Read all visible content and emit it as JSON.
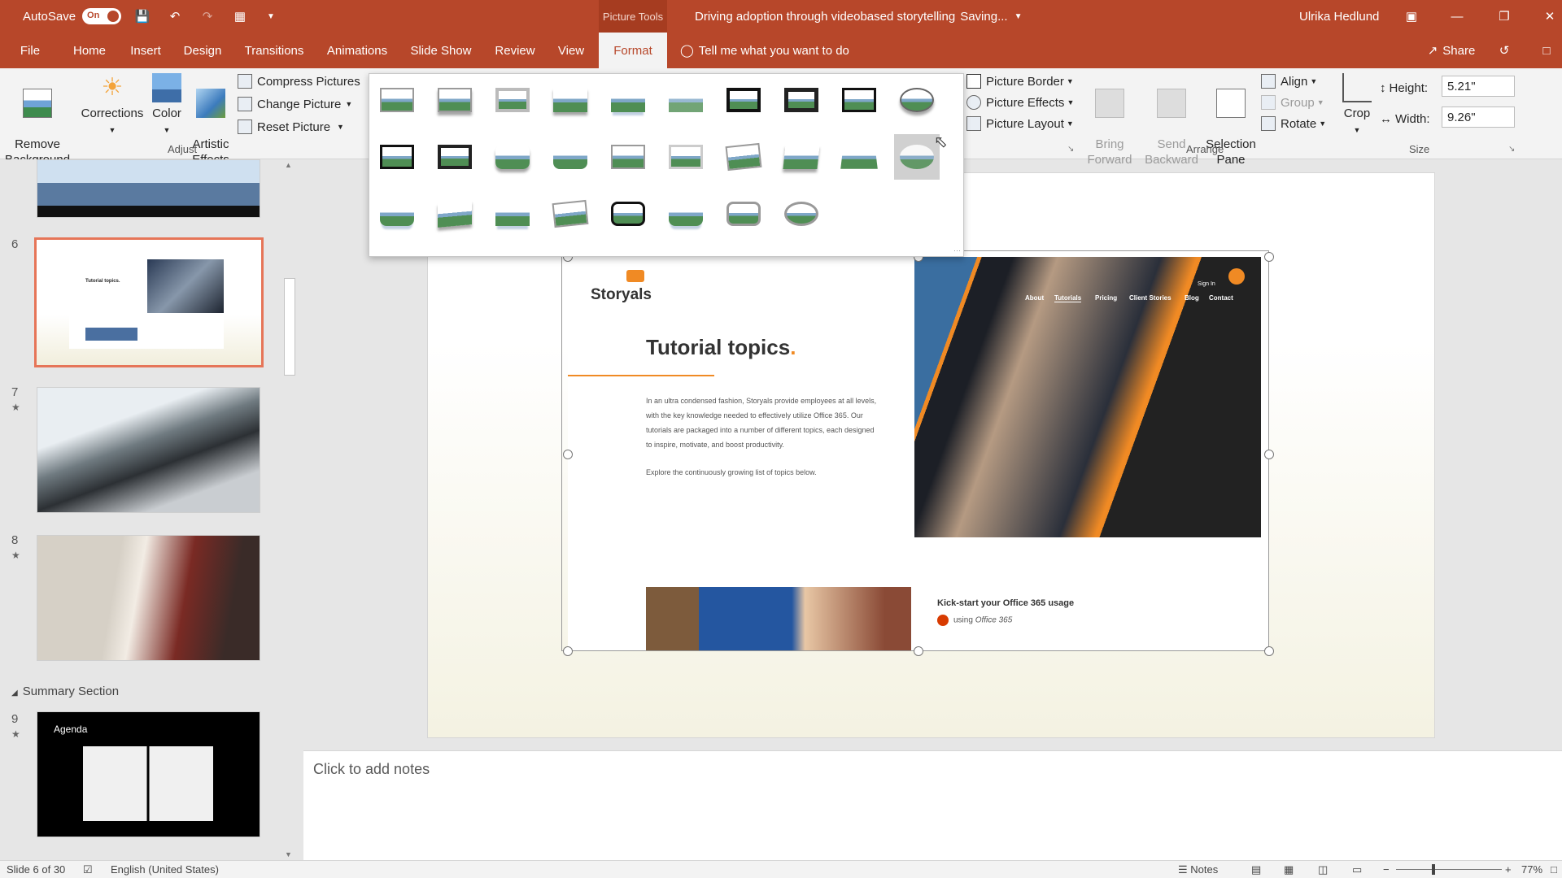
{
  "titlebar": {
    "autosave_label": "AutoSave",
    "autosave_state": "On",
    "context_tab": "Picture Tools",
    "doc_title": "Driving adoption through videobased storytelling",
    "save_status": "Saving...",
    "user_name": "Ulrika Hedlund"
  },
  "tabs": [
    {
      "label": "File"
    },
    {
      "label": "Home"
    },
    {
      "label": "Insert"
    },
    {
      "label": "Design"
    },
    {
      "label": "Transitions"
    },
    {
      "label": "Animations"
    },
    {
      "label": "Slide Show"
    },
    {
      "label": "Review"
    },
    {
      "label": "View"
    },
    {
      "label": "Format"
    }
  ],
  "tell_me": "Tell me what you want to do",
  "share_label": "Share",
  "ribbon": {
    "remove_background": "Remove\nBackground",
    "corrections": "Corrections",
    "color": "Color",
    "artistic_effects": "Artistic\nEffects",
    "compress_pictures": "Compress Pictures",
    "change_picture": "Change Picture",
    "reset_picture": "Reset Picture",
    "adjust_group": "Adjust",
    "picture_border": "Picture Border",
    "picture_effects": "Picture Effects",
    "picture_layout": "Picture Layout",
    "bring_forward": "Bring\nForward",
    "send_backward": "Send\nBackward",
    "selection_pane": "Selection\nPane",
    "align": "Align",
    "group": "Group",
    "rotate": "Rotate",
    "arrange_group": "Arrange",
    "crop": "Crop",
    "height_label": "Height:",
    "height_value": "5.21\"",
    "width_label": "Width:",
    "width_value": "9.26\"",
    "size_group": "Size"
  },
  "slides": {
    "slide6_num": "6",
    "slide7_num": "7",
    "slide8_num": "8",
    "section_label": "Summary Section",
    "slide9_num": "9",
    "slide9_title": "Agenda",
    "slide6_thumb_title": "Tutorial topics."
  },
  "picture": {
    "brand": "Storyals",
    "heading": "Tutorial topics",
    "heading_dot": ".",
    "paragraph": "In an ultra condensed fashion, Storyals provide employees at all levels, with the key knowledge needed to effectively utilize Office 365. Our tutorials are packaged into a number of different topics, each designed to inspire, motivate, and boost productivity.",
    "paragraph2": "Explore the continuously growing list of topics below.",
    "nav": [
      "About",
      "Tutorials",
      "Pricing",
      "Client Stories",
      "Blog",
      "Contact"
    ],
    "sign_in": "Sign In",
    "kick_title": "Kick-start your Office 365 usage",
    "kick_sub": "using",
    "kick_sub_em": "Office 365"
  },
  "notes_placeholder": "Click to add notes",
  "status": {
    "slide_info": "Slide 6 of 30",
    "language": "English (United States)",
    "notes": "Notes",
    "zoom": "77%"
  }
}
